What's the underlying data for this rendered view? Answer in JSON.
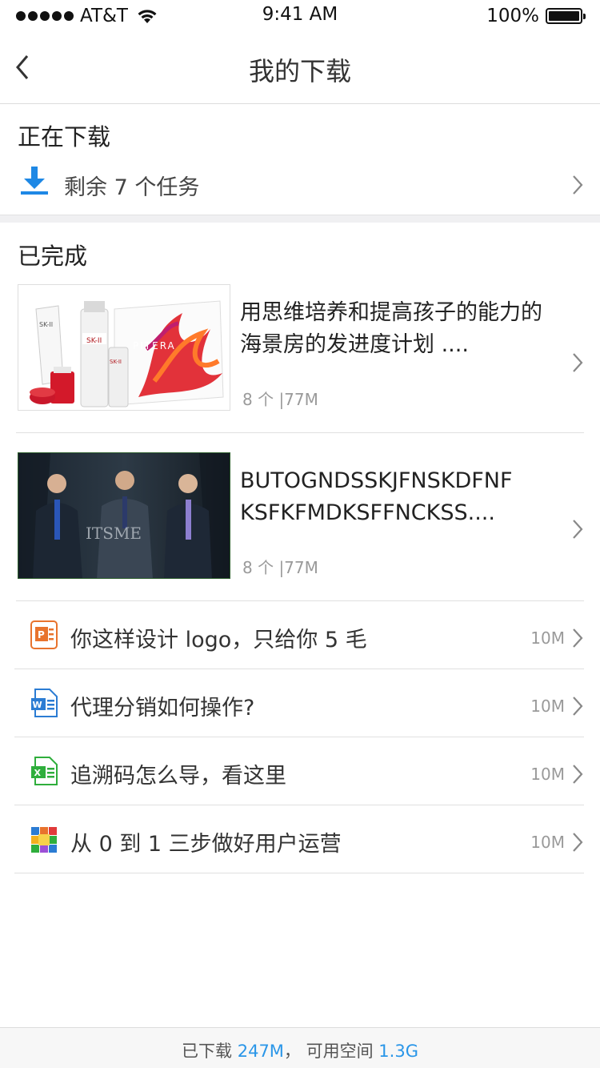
{
  "status_bar": {
    "carrier": "AT&T",
    "time": "9:41 AM",
    "battery": "100%",
    "icons": [
      "signal-dots-icon",
      "wifi-icon",
      "battery-icon"
    ]
  },
  "nav": {
    "title": "我的下载",
    "back_icon": "chevron-left-icon"
  },
  "downloading": {
    "section_title": "正在下载",
    "summary": "剩余 7 个任务",
    "icon": "download-arrow-icon"
  },
  "completed": {
    "section_title": "已完成",
    "media_items": [
      {
        "title": "用思维培养和提高孩子的能力的海景房的发进度计划 ....",
        "meta": "8 个 |77M",
        "thumbnail": "skincare-products-image"
      },
      {
        "title": "BUTOGNDSSKJFNSKDFNF KSFKFMDKSFFNCKSS....",
        "meta": "8 个 |77M",
        "thumbnail": "three-men-portrait-image",
        "watermark": "ITSME"
      }
    ],
    "doc_items": [
      {
        "title": "你这样设计 logo，只给你 5 毛",
        "size": "10M",
        "icon": "powerpoint-file-icon"
      },
      {
        "title": "代理分销如何操作?",
        "size": "10M",
        "icon": "word-file-icon"
      },
      {
        "title": "追溯码怎么导，看这里",
        "size": "10M",
        "icon": "excel-file-icon"
      },
      {
        "title": "从 0 到 1 三步做好用户运营",
        "size": "10M",
        "icon": "colorful-grid-file-icon"
      }
    ]
  },
  "footer": {
    "downloaded_label": "已下载",
    "downloaded_value": "247M",
    "separator": "，",
    "available_label": "可用空间",
    "available_value": "1.3G"
  },
  "colors": {
    "accent": "#2a96e8",
    "ppt": "#e8732d",
    "word": "#2b7cd3",
    "excel": "#2fae3c"
  }
}
